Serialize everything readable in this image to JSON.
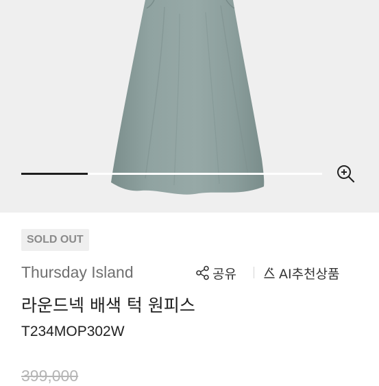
{
  "gallery": {
    "progress": 0.22
  },
  "product": {
    "badge": "SOLD OUT",
    "brand": "Thursday Island",
    "share_label": "공유",
    "ai_label": "AI추천상품",
    "title": "라운드넥 배색 턱 원피스",
    "code": "T234MOP302W",
    "original_price": "399,000"
  },
  "icons": {
    "zoom": "zoom-in-icon",
    "share": "share-icon",
    "ai": "ai-recommend-icon"
  }
}
